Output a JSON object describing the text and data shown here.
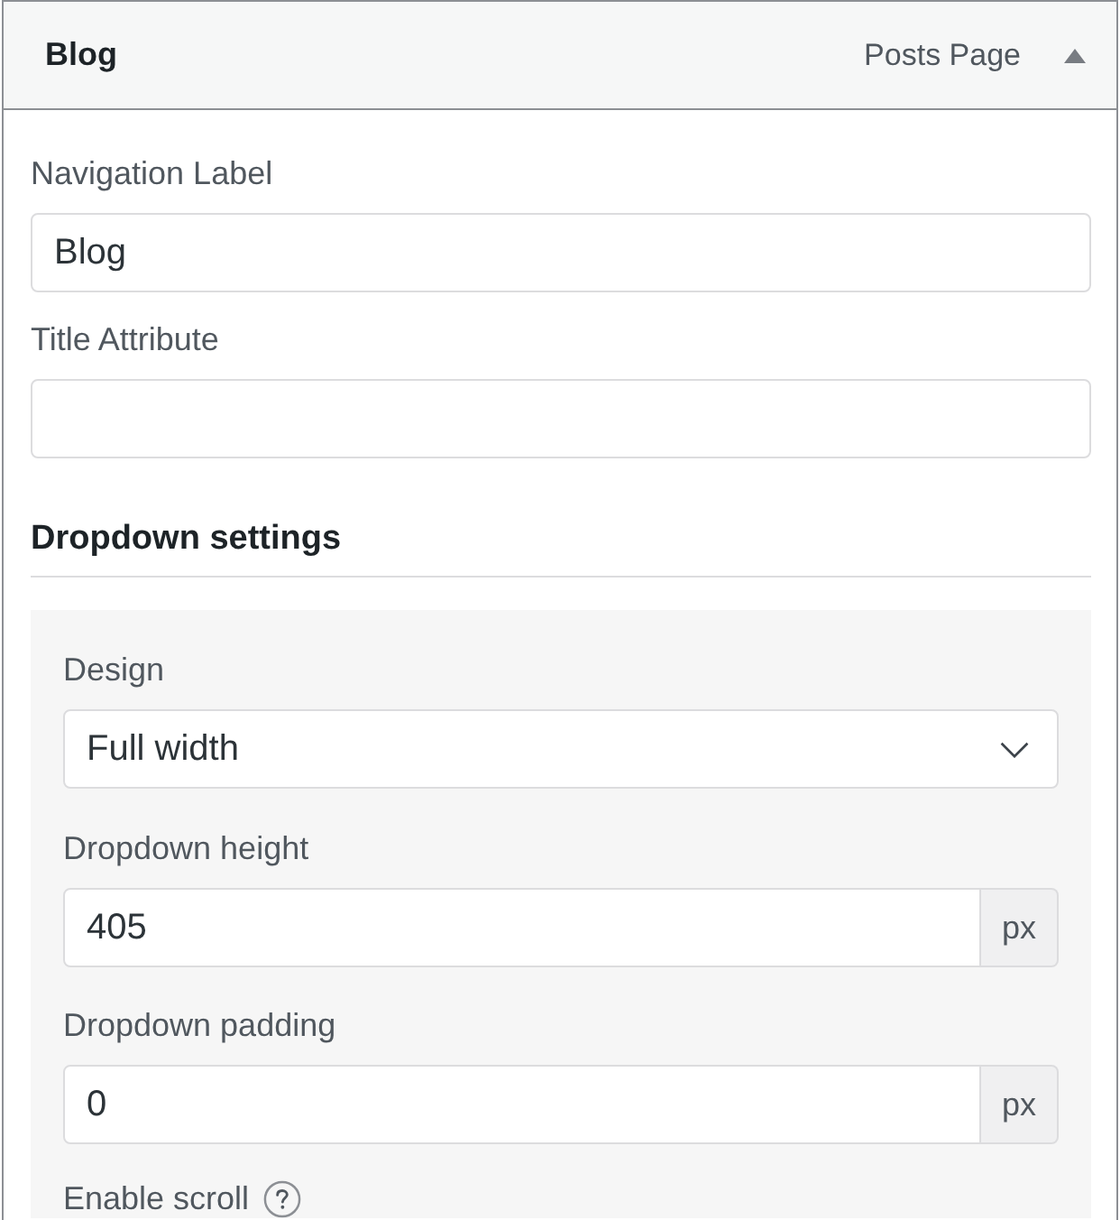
{
  "panel": {
    "title": "Blog",
    "type_label": "Posts Page",
    "expanded": true
  },
  "fields": [
    {
      "kind": "text",
      "label": "Navigation Label",
      "value": "Blog"
    },
    {
      "kind": "text",
      "label": "Title Attribute"
    }
  ],
  "section": {
    "title": "Dropdown settings",
    "fields": [
      {
        "kind": "select",
        "label": "Design",
        "value": "Full width"
      },
      {
        "kind": "unit",
        "label": "Dropdown height",
        "value": "405",
        "unit": "px"
      },
      {
        "kind": "unit",
        "label": "Dropdown padding",
        "value": "0",
        "unit": "px"
      },
      {
        "kind": "heading",
        "label": "Enable scroll",
        "help": true
      }
    ]
  }
}
